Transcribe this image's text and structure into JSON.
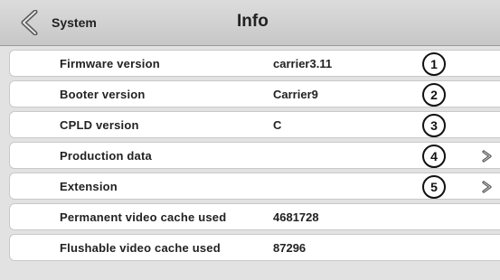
{
  "header": {
    "back_label": "System",
    "title": "Info"
  },
  "rows": [
    {
      "label": "Firmware version",
      "value": "carrier3.11",
      "callout": "1"
    },
    {
      "label": "Booter version",
      "value": "Carrier9",
      "callout": "2"
    },
    {
      "label": "CPLD version",
      "value": "C",
      "callout": "3"
    },
    {
      "label": "Production data",
      "value": "",
      "callout": "4"
    },
    {
      "label": "Extension",
      "value": "",
      "callout": "5"
    },
    {
      "label": "Permanent video cache used",
      "value": "4681728"
    },
    {
      "label": "Flushable video cache used",
      "value": "87296"
    }
  ],
  "icons": {
    "back": "chevron-left-icon",
    "row_arrow": "chevron-right-icon"
  },
  "colors": {
    "header_bg": "#d2d2d2",
    "row_bg": "#ffffff",
    "screen_bg": "#e2e2e2",
    "text": "#222222"
  }
}
